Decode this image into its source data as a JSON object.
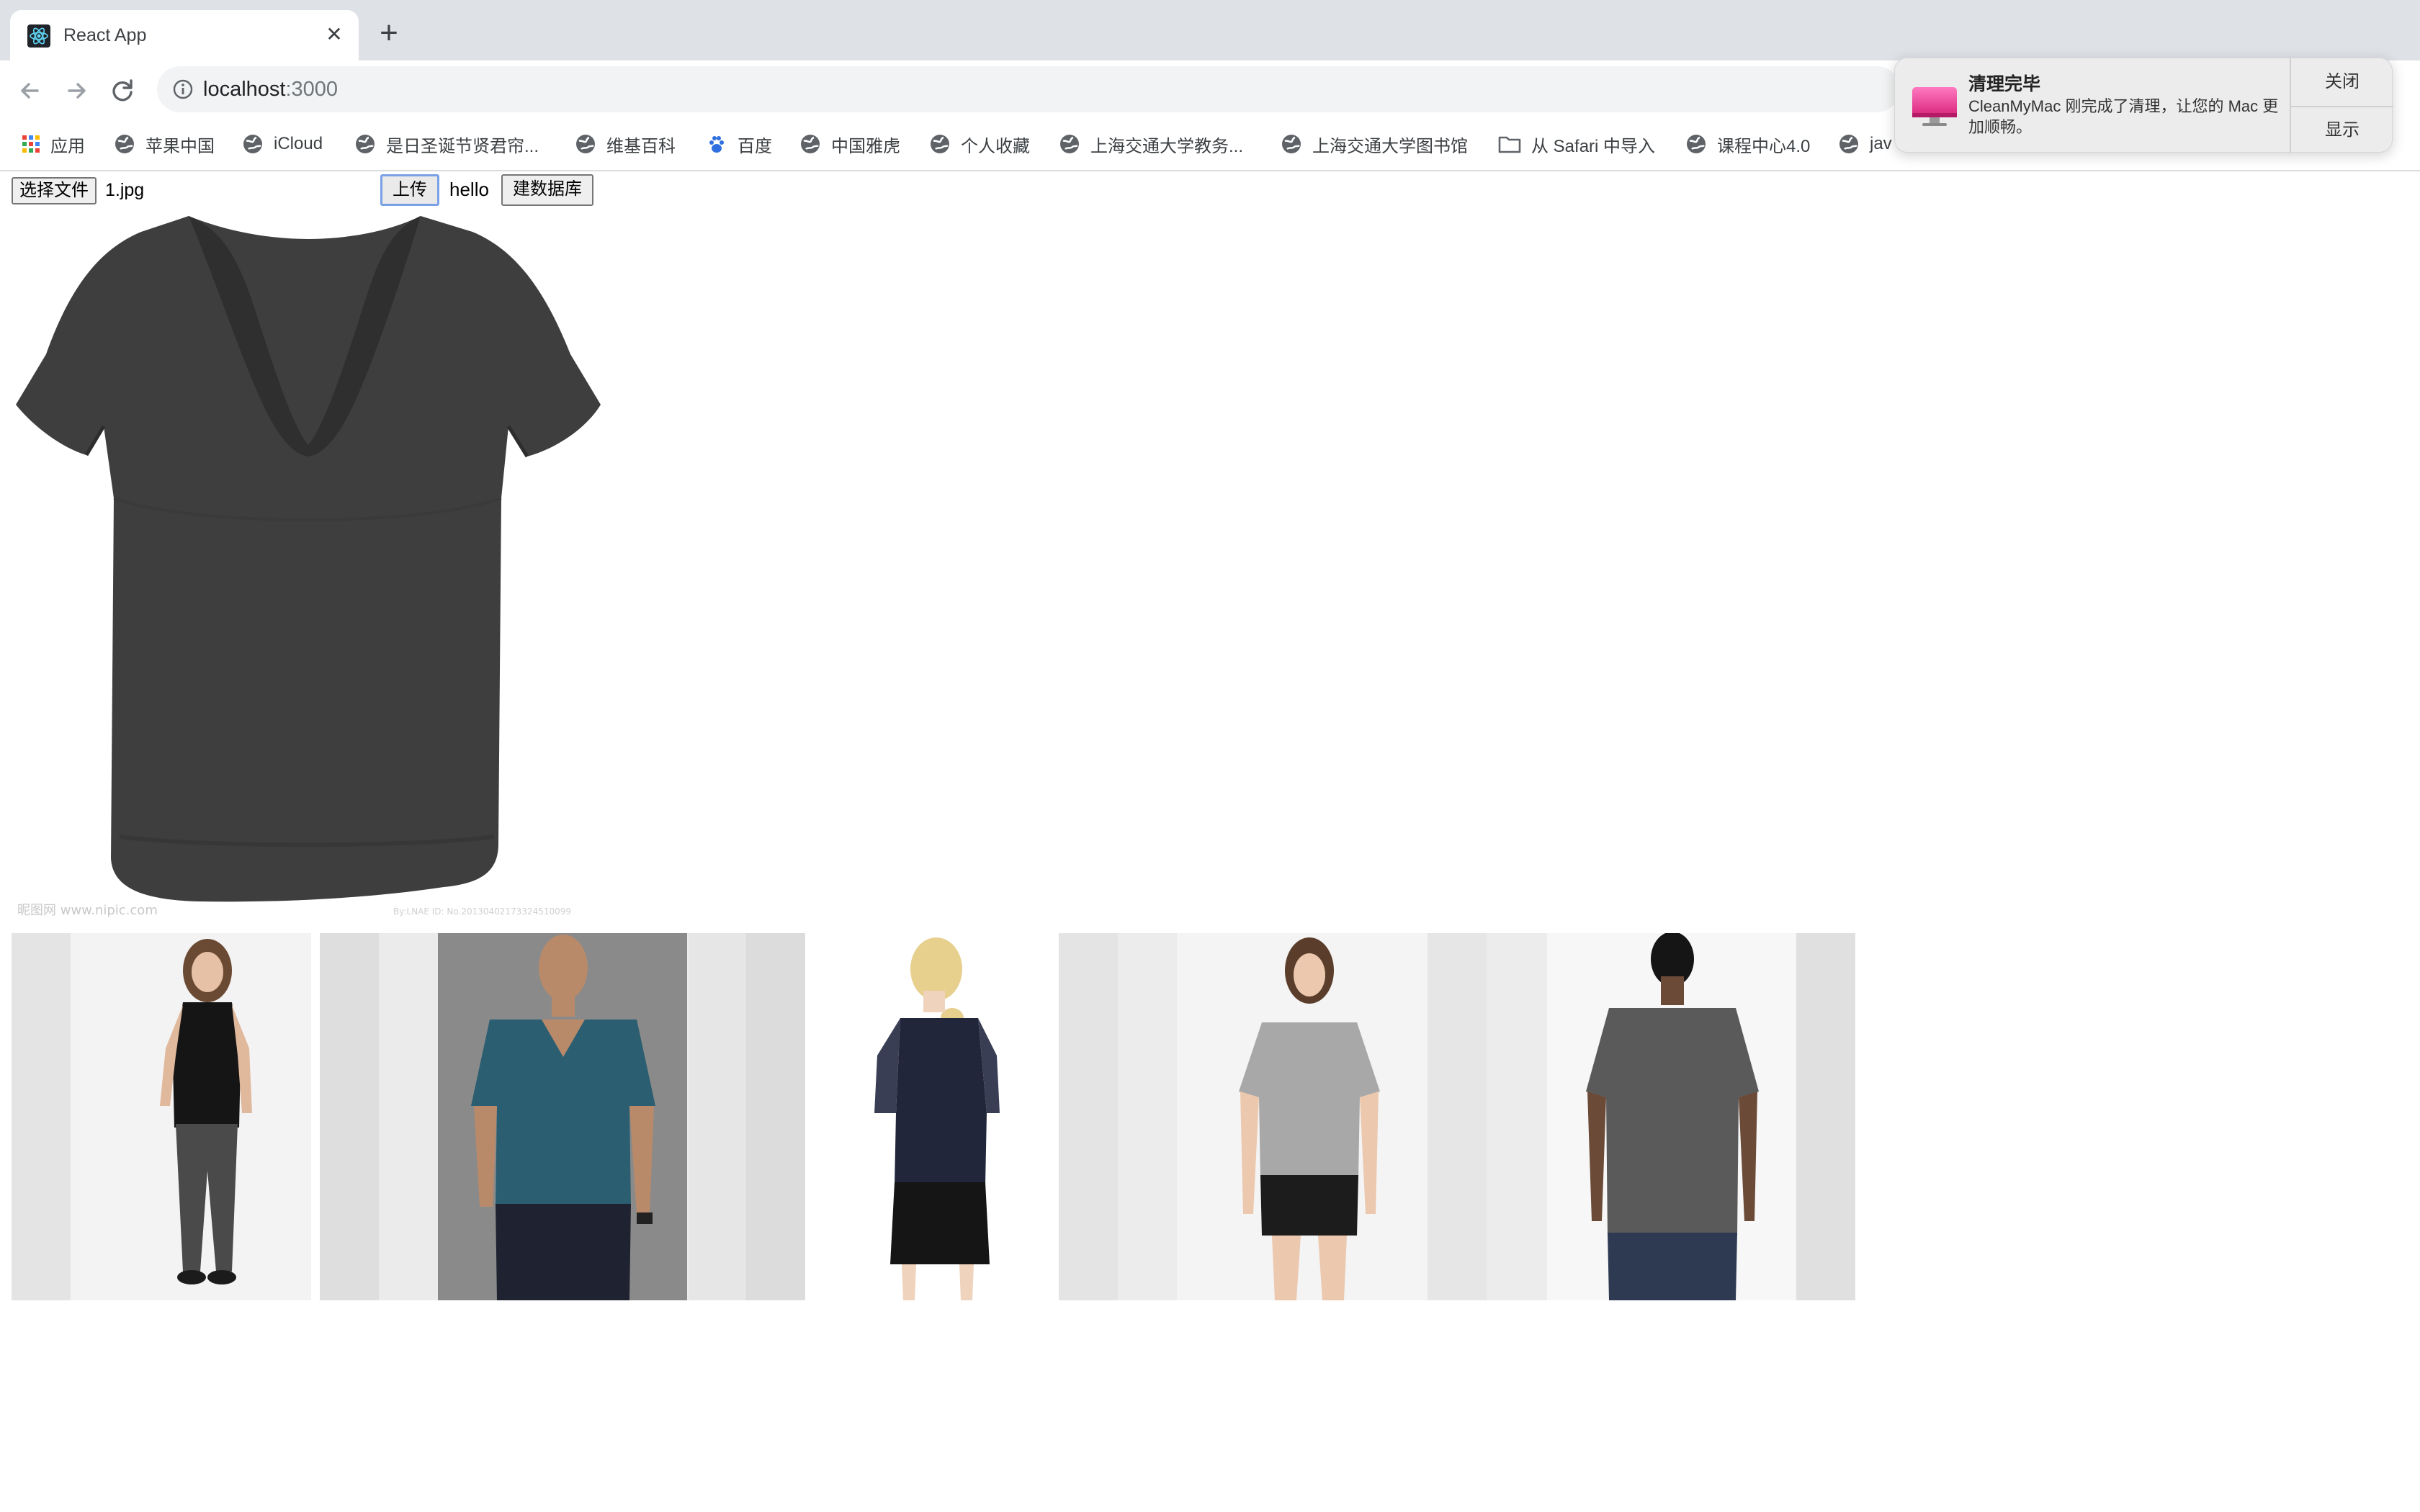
{
  "browser": {
    "tab_title": "React App",
    "url_host": "localhost",
    "url_port": ":3000"
  },
  "bookmarks": [
    {
      "label": "应用",
      "icon": "apps-grid-icon"
    },
    {
      "label": "苹果中国",
      "icon": "globe-icon"
    },
    {
      "label": "iCloud",
      "icon": "globe-icon"
    },
    {
      "label": "是日圣诞节贤君帘...",
      "icon": "globe-icon"
    },
    {
      "label": "维基百科",
      "icon": "globe-icon"
    },
    {
      "label": "百度",
      "icon": "baidu-paw-icon"
    },
    {
      "label": "中国雅虎",
      "icon": "globe-icon"
    },
    {
      "label": "个人收藏",
      "icon": "globe-icon"
    },
    {
      "label": "上海交通大学教务...",
      "icon": "globe-icon"
    },
    {
      "label": "上海交通大学图书馆",
      "icon": "globe-icon"
    },
    {
      "label": "从 Safari 中导入",
      "icon": "folder-icon"
    },
    {
      "label": "课程中心4.0",
      "icon": "globe-icon"
    },
    {
      "label": "jav",
      "icon": "globe-icon"
    }
  ],
  "page": {
    "choose_file_label": "选择文件",
    "file_name": "1.jpg",
    "upload_label": "上传",
    "hello_text": "hello",
    "build_db_label": "建数据库"
  },
  "main_image": {
    "watermark_left": "昵图网 www.nipic.com",
    "watermark_right": "By:LNAE ID: No.20130402173324510099",
    "colors": {
      "shirt": "#3e3e3e"
    }
  },
  "results": [
    {
      "icon": "woman-black-tee-photo",
      "colors": {
        "bg": "#f3f3f3",
        "top": "#151515",
        "bottom": "#4a4a4a"
      }
    },
    {
      "icon": "man-teal-vneck-photo",
      "colors": {
        "bg": "#ebebeb",
        "top": "#2b5e70",
        "bottom": "#1f2230"
      }
    },
    {
      "icon": "woman-navy-sequin-top-photo",
      "colors": {
        "bg": "#ffffff",
        "top": "#22263a",
        "bottom": "#151515"
      }
    },
    {
      "icon": "woman-grey-tee-photo",
      "colors": {
        "bg": "#f4f4f4",
        "top": "#a8a8a8",
        "bottom": "#1c1c1c"
      }
    },
    {
      "icon": "man-grey-tee-back-photo",
      "colors": {
        "bg": "#ececec",
        "top": "#5a5a5a",
        "bottom": "#2e3a52"
      }
    }
  ],
  "notification": {
    "title": "清理完毕",
    "body": "CleanMyMac 刚完成了清理，让您的 Mac 更加顺畅。",
    "close_label": "关闭",
    "show_label": "显示",
    "icon": "cleanmymac-icon"
  }
}
